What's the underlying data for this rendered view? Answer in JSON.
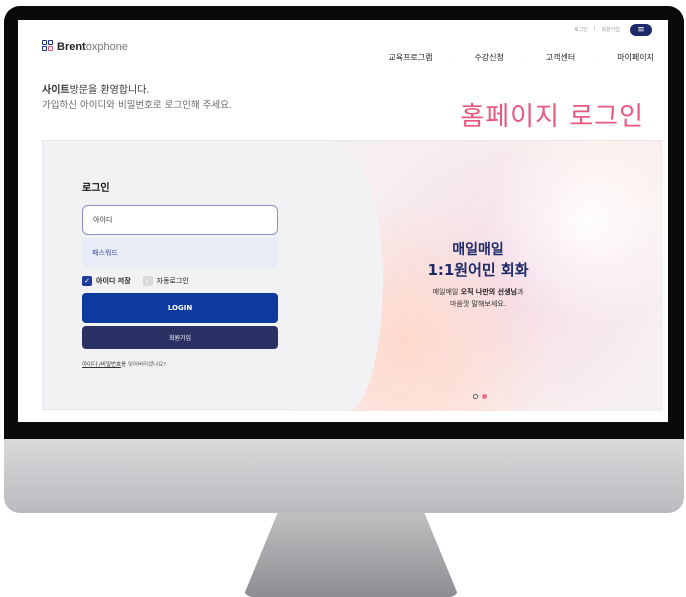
{
  "header": {
    "logo_brand": "Brent",
    "logo_sub": "oxphone",
    "util_links": [
      "로그인",
      "회원가입"
    ],
    "menu_icon": "hamburger-icon",
    "nav": [
      "교육프로그램",
      "수강신청",
      "고객센터",
      "마이페이지"
    ]
  },
  "intro": {
    "welcome_bold": "사이트",
    "welcome_rest": "방문을 환영합니다.",
    "welcome_sub": "가입하신 아이디와 비밀번호로 로그인해 주세요.",
    "heading": "홈페이지 로그인"
  },
  "login": {
    "title": "로그인",
    "id_placeholder": "아이디",
    "pw_placeholder": "패스워드",
    "save_id_label": "아이디 저장",
    "save_id_checked": true,
    "auto_login_label": "자동로그인",
    "auto_login_checked": false,
    "login_button": "LOGIN",
    "signup_button": "회원가입",
    "forgot_link": "아이디 /비밀번호",
    "forgot_suffix": "를 잊어버리셨나요?"
  },
  "hero": {
    "title1": "매일매일",
    "title2": "1:1원어민 회화",
    "desc1_prefix": "매일매일 ",
    "desc1_bold": "오직 나만의 선생님",
    "desc1_suffix": "과",
    "desc2": "마음껏 말해보세요.",
    "slide_count": 2,
    "active_slide": 1
  },
  "colors": {
    "brand_navy": "#1d2a6a",
    "login_button": "#0d3a9f",
    "heading_pink": "#e9577d"
  }
}
